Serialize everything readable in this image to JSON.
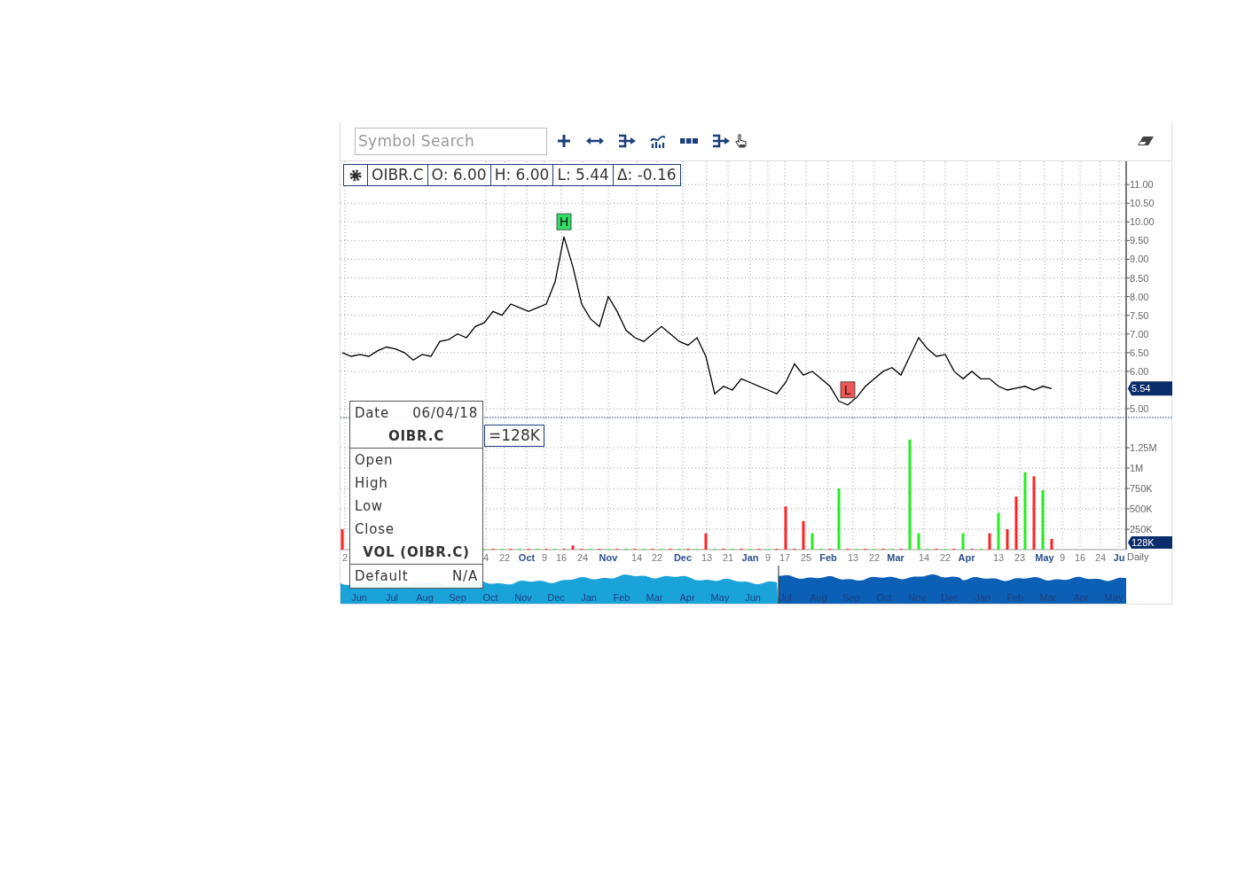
{
  "toolbar": {
    "search": {
      "placeholder": "Symbol Search"
    }
  },
  "price_panel": {
    "legend": {
      "open": "O: 6.00",
      "high": "H: 6.00",
      "low": "L: 5.44",
      "change": "Δ: -0.16"
    },
    "price_tag": "5.54",
    "markers": [
      {
        "kind": "high",
        "label": "H",
        "color": "#33dd66"
      },
      {
        "kind": "low",
        "label": "L",
        "color": "#ee5555"
      }
    ],
    "chart_data": {
      "type": "line",
      "grid": true,
      "ylim": [
        4.74,
        11.62
      ],
      "yticks": [
        {
          "value": 11,
          "label": "11.00"
        },
        {
          "value": 10.5,
          "label": "10.50"
        },
        {
          "value": 10,
          "label": "10.00"
        },
        {
          "value": 9.5,
          "label": "9.50"
        },
        {
          "value": 9,
          "label": "9.00"
        },
        {
          "value": 8.5,
          "label": "8.50"
        },
        {
          "value": 8,
          "label": "8.00"
        },
        {
          "value": 7.5,
          "label": "7.50"
        },
        {
          "value": 7,
          "label": "7.00"
        },
        {
          "value": 6.5,
          "label": "6.50"
        },
        {
          "value": 6,
          "label": "6.00"
        },
        {
          "value": 5,
          "label": "5.00"
        }
      ],
      "series": [
        {
          "name": "OIBR.C",
          "color": "#000000",
          "values": [
            6.5,
            6.4,
            6.45,
            6.4,
            6.55,
            6.65,
            6.6,
            6.5,
            6.3,
            6.45,
            6.4,
            6.8,
            6.85,
            7.0,
            6.9,
            7.2,
            7.3,
            7.6,
            7.5,
            7.8,
            7.7,
            7.6,
            7.7,
            7.8,
            8.4,
            9.6,
            8.8,
            7.8,
            7.4,
            7.2,
            8.0,
            7.6,
            7.1,
            6.9,
            6.8,
            7.0,
            7.2,
            7.0,
            6.8,
            6.7,
            6.9,
            6.4,
            5.4,
            5.6,
            5.5,
            5.8,
            5.7,
            5.6,
            5.5,
            5.4,
            5.7,
            6.2,
            5.9,
            6.0,
            5.8,
            5.6,
            5.2,
            5.1,
            5.3,
            5.6,
            5.8,
            6.0,
            6.1,
            5.9,
            6.4,
            6.9,
            6.6,
            6.4,
            6.45,
            6.0,
            5.8,
            6.0,
            5.8,
            5.8,
            5.6,
            5.5,
            5.55,
            5.6,
            5.5,
            5.6,
            5.54,
            null,
            null,
            null,
            null,
            null,
            null,
            null,
            null
          ]
        }
      ]
    }
  },
  "volume_panel": {
    "legend": {
      "value": "=128K"
    },
    "volume_tag": "128K",
    "interval": "Daily",
    "date_axis": [
      {
        "label": "2",
        "kind": "day"
      },
      {
        "label": "4",
        "kind": "day"
      },
      {
        "label": "22",
        "kind": "day"
      },
      {
        "label": "Oct",
        "kind": "month"
      },
      {
        "label": "9",
        "kind": "day"
      },
      {
        "label": "16",
        "kind": "day"
      },
      {
        "label": "24",
        "kind": "day"
      },
      {
        "label": "Nov",
        "kind": "month"
      },
      {
        "label": "14",
        "kind": "day"
      },
      {
        "label": "22",
        "kind": "day"
      },
      {
        "label": "Dec",
        "kind": "month"
      },
      {
        "label": "13",
        "kind": "day"
      },
      {
        "label": "21",
        "kind": "day"
      },
      {
        "label": "Jan",
        "kind": "month"
      },
      {
        "label": "9",
        "kind": "day"
      },
      {
        "label": "17",
        "kind": "day"
      },
      {
        "label": "25",
        "kind": "day"
      },
      {
        "label": "Feb",
        "kind": "month"
      },
      {
        "label": "13",
        "kind": "day"
      },
      {
        "label": "22",
        "kind": "day"
      },
      {
        "label": "Mar",
        "kind": "month"
      },
      {
        "label": "14",
        "kind": "day"
      },
      {
        "label": "22",
        "kind": "day"
      },
      {
        "label": "Apr",
        "kind": "month"
      },
      {
        "label": "13",
        "kind": "day"
      },
      {
        "label": "23",
        "kind": "day"
      },
      {
        "label": "May",
        "kind": "month"
      },
      {
        "label": "9",
        "kind": "day"
      },
      {
        "label": "16",
        "kind": "day"
      },
      {
        "label": "24",
        "kind": "day"
      },
      {
        "label": "Ju",
        "kind": "month"
      }
    ],
    "chart_data": {
      "type": "bar",
      "grid": true,
      "ylim": [
        0,
        1610000
      ],
      "yticks": [
        {
          "value": 1250000,
          "label": "1.25M"
        },
        {
          "value": 1000000,
          "label": "1M"
        },
        {
          "value": 750000,
          "label": "750K"
        },
        {
          "value": 500000,
          "label": "500K"
        },
        {
          "value": 250000,
          "label": "250K"
        }
      ],
      "series": [
        {
          "color": "#22ee22",
          "values": [
            null,
            null,
            null,
            null,
            null,
            null,
            null,
            null,
            null,
            null,
            null,
            null,
            null,
            null,
            null,
            null,
            10000,
            null,
            10000,
            null,
            10000,
            null,
            10000,
            null,
            10000,
            null,
            null,
            null,
            10000,
            null,
            10000,
            null,
            10000,
            null,
            10000,
            null,
            10000,
            null,
            10000,
            null,
            10000,
            null,
            10000,
            null,
            10000,
            null,
            10000,
            null,
            10000,
            null,
            null,
            null,
            null,
            200000,
            10000,
            null,
            750000,
            null,
            10000,
            null,
            10000,
            null,
            10000,
            null,
            1350000,
            200000,
            10000,
            null,
            10000,
            null,
            200000,
            null,
            10000,
            null,
            450000,
            null,
            null,
            950000,
            null,
            730000,
            null,
            null,
            null,
            null,
            null,
            null,
            null,
            null,
            null
          ]
        },
        {
          "color": "#ff2222",
          "values": [
            250000,
            null,
            null,
            null,
            null,
            null,
            null,
            null,
            null,
            null,
            null,
            null,
            null,
            null,
            null,
            null,
            null,
            10000,
            null,
            10000,
            null,
            10000,
            null,
            10000,
            null,
            10000,
            50000,
            10000,
            null,
            10000,
            null,
            10000,
            null,
            10000,
            null,
            10000,
            null,
            10000,
            null,
            10000,
            null,
            200000,
            null,
            10000,
            null,
            10000,
            null,
            10000,
            null,
            10000,
            530000,
            10000,
            350000,
            null,
            null,
            10000,
            null,
            10000,
            null,
            10000,
            null,
            10000,
            null,
            10000,
            null,
            null,
            null,
            10000,
            null,
            10000,
            null,
            10000,
            null,
            200000,
            null,
            250000,
            650000,
            null,
            900000,
            null,
            130000,
            null,
            null,
            null,
            null,
            null,
            null,
            null,
            null
          ]
        }
      ]
    }
  },
  "navigator": {
    "labels": [
      "Jun",
      "Jul",
      "Aug",
      "Sep",
      "Oct",
      "Nov",
      "Dec",
      "Jan",
      "Feb",
      "Mar",
      "Apr",
      "May",
      "Jun",
      "Jul",
      "Aug",
      "Sep",
      "Oct",
      "Nov",
      "Dec",
      "Jan",
      "Feb",
      "Mar",
      "Apr",
      "May"
    ]
  },
  "tooltip": {
    "date_label": "Date",
    "date": "06/04/18",
    "symbol": "OIBR.C",
    "fields": [
      "Open",
      "High",
      "Low",
      "Close"
    ],
    "study": "VOL (OIBR.C)",
    "default_label": "Default",
    "default_value": "N/A"
  }
}
